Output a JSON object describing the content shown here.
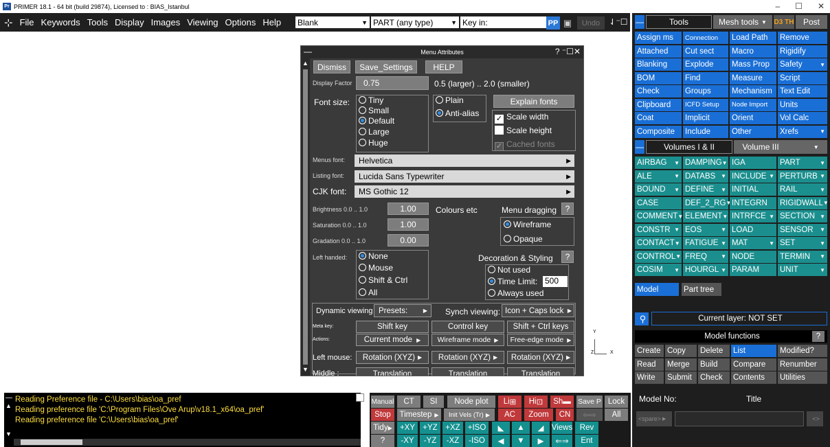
{
  "titlebar": {
    "text": "PRIMER 18.1 - 64 bit (build 29874), Licensed to : BIAS_Istanbul",
    "icon": "primer-app-icon",
    "min": "–",
    "max": "☐",
    "close": "✕"
  },
  "menu": {
    "items": [
      "File",
      "Keywords",
      "Tools",
      "Display",
      "Images",
      "Viewing",
      "Options",
      "Help"
    ],
    "blank": "Blank",
    "part": "PART (any type)",
    "keyin": "Key in:",
    "pp": "PP",
    "undo": "Undo"
  },
  "dialog": {
    "title": "Menu Attributes",
    "dismiss": "Dismiss",
    "save": "Save_Settings",
    "help": "HELP",
    "display_factor_label": "Display Factor",
    "display_factor": "0.75",
    "display_factor_hint": "0.5 (larger) .. 2.0 (smaller)",
    "font_size_label": "Font size:",
    "sizes": [
      "Tiny",
      "Small",
      "Default",
      "Large",
      "Huge"
    ],
    "size_selected": "Default",
    "plain": "Plain",
    "antialias": "Anti-alias",
    "explain_fonts": "Explain fonts",
    "scale_width": "Scale width",
    "scale_height": "Scale height",
    "cached_fonts": "Cached fonts",
    "menus_font_label": "Menus font:",
    "menus_font": "Helvetica",
    "listing_font_label": "Listing font:",
    "listing_font": "Lucida Sans Typewriter",
    "cjk_font_label": "CJK font:",
    "cjk_font": "MS Gothic 12",
    "brightness_label": "Brightness 0.0 .. 1.0",
    "brightness": "1.00",
    "saturation_label": "Saturation 0.0 .. 1.0",
    "saturation": "1.00",
    "gradation_label": "Gradation 0.0 .. 1.0",
    "gradation": "0.00",
    "colours_label": "Colours etc",
    "menu_dragging": "Menu dragging",
    "q": "?",
    "wireframe": "Wireframe",
    "opaque": "Opaque",
    "left_handed_label": "Left handed:",
    "lh_opts": [
      "None",
      "Mouse",
      "Shift & Ctrl",
      "All"
    ],
    "decoration": "Decoration & Styling",
    "not_used": "Not used",
    "time_limit": "Time Limit:",
    "time_limit_val": "500",
    "always_used": "Always used",
    "dynamic_viewing": "Dynamic viewing",
    "presets": "Presets:",
    "synch_viewing": "Synch viewing:",
    "icon_caps": "Icon + Caps lock",
    "meta_key": "Meta key:",
    "shift_key": "Shift key",
    "control_key": "Control key",
    "shift_ctrl": "Shift + Ctrl keys",
    "actions": "Actions:",
    "current_mode": "Current mode",
    "wireframe_mode": "Wireframe mode",
    "free_edge": "Free-edge mode",
    "left_mouse": "Left mouse:",
    "rotation": "Rotation (XYZ)",
    "middle": "Middle :",
    "translation": "Translation"
  },
  "console": {
    "lines": [
      "Reading Preference file - C:\\Users\\bias\\oa_pref",
      "Reading preference file 'C:\\Program Files\\Ove Arup\\v18.1_x64\\oa_pref'",
      "Reading preference file 'C:\\Users\\bias\\oa_pref'"
    ]
  },
  "controls": {
    "manual": "Manual",
    "ct": "CT",
    "si": "SI",
    "node_plot": "Node plot",
    "li": "Li",
    "hi": "Hi",
    "sh": "Sh",
    "save_p": "Save P",
    "lock": "Lock",
    "stop": "Stop",
    "timestep": "Timestep",
    "init_vels": "Init Vels (Tr)",
    "ac": "AC",
    "zoom": "Zoom",
    "cn": "CN",
    "all": "All",
    "tidy": "Tidy",
    "pxy": "+XY",
    "pyz": "+YZ",
    "pxz": "+XZ",
    "piso": "+ISO",
    "views": "Views",
    "rev": "Rev",
    "qm": "?",
    "mxy": "-XY",
    "myz": "-YZ",
    "mxz": "-XZ",
    "miso": "-ISO",
    "ent": "Ent"
  },
  "axes": {
    "y": "Y",
    "x": "X",
    "z": "Z"
  },
  "right": {
    "tabs": [
      "Tools",
      "Mesh tools",
      "Post"
    ],
    "dth": "D3 TH",
    "tools": [
      "Assign ms",
      "Connection",
      "Load Path",
      "Remove",
      "Attached",
      "Cut sect",
      "Macro",
      "Rigidify",
      "Blanking",
      "Explode",
      "Mass Prop",
      "Safety",
      "BOM",
      "Find",
      "Measure",
      "Script",
      "Check",
      "Groups",
      "Mechanism",
      "Text Edit",
      "Clipboard",
      "ICFD Setup",
      "Node Import",
      "Units",
      "Coat",
      "Implicit",
      "Orient",
      "Vol Calc",
      "Composite",
      "Include",
      "Other",
      "Xrefs"
    ],
    "vol_tabs": [
      "Volumes I & II",
      "Volume III"
    ],
    "keywords": [
      "AIRBAG",
      "DAMPING",
      "IGA",
      "PART",
      "ALE",
      "DATABS",
      "INCLUDE",
      "PERTURB",
      "BOUND",
      "DEFINE",
      "INITIAL",
      "RAIL",
      "CASE",
      "DEF_2_RG",
      "INTEGRN",
      "RIGIDWALL",
      "COMMENT",
      "ELEMENT",
      "INTRFCE",
      "SECTION",
      "CONSTR",
      "EOS",
      "LOAD",
      "SENSOR",
      "CONTACT",
      "FATIGUE",
      "MAT",
      "SET",
      "CONTROL",
      "FREQ",
      "NODE",
      "TERMIN",
      "COSIM",
      "HOURGL",
      "PARAM",
      "UNIT"
    ],
    "model": "Model",
    "part_tree": "Part tree",
    "layer": "Current layer: NOT SET",
    "model_functions": "Model functions",
    "mf_q": "?",
    "mf": [
      "Create",
      "Copy",
      "Delete",
      "List",
      "Modified?",
      "Read",
      "Merge",
      "Build",
      "Compare",
      "Renumber",
      "Write",
      "Submit",
      "Check",
      "Contents",
      "Utilities"
    ],
    "model_no": "Model No:",
    "title": "Title",
    "spare": "<spare>",
    "arrows": "<>"
  }
}
